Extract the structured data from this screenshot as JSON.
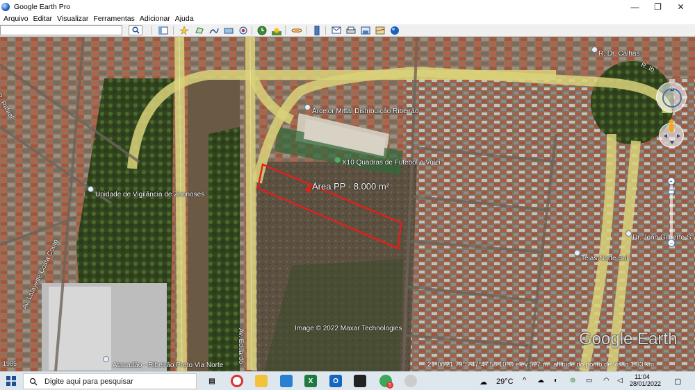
{
  "window": {
    "title": "Google Earth Pro",
    "minimize": "—",
    "maximize": "❐",
    "close": "✕"
  },
  "menu": [
    "Arquivo",
    "Editar",
    "Visualizar",
    "Ferramentas",
    "Adicionar",
    "Ajuda"
  ],
  "search": {
    "value": "",
    "button_icon": "search-icon"
  },
  "toolbar": {
    "icons": [
      "sidebar-icon",
      "placemark-icon",
      "polygon-icon",
      "path-icon",
      "overlay-icon",
      "record-tour-icon",
      "historical-imagery-icon",
      "sun-icon",
      "planets-icon",
      "ruler-icon",
      "email-icon",
      "print-icon",
      "save-image-icon",
      "map-icon",
      "earth-icon"
    ]
  },
  "map": {
    "polygon_label": "Área PP - 8.000 m²",
    "places": [
      {
        "name": "Arcelor Mittal Distribuição Ribeirão"
      },
      {
        "name": "X10 Quadras de Futebol e Volei"
      },
      {
        "name": "Unidade de Vigilância de Zoonoses"
      },
      {
        "name": "R. Dr. Calhas"
      },
      {
        "name": "Dr. João Gilberto S"
      },
      {
        "name": "Telas Norte Sul"
      },
      {
        "name": "Atacadão - Ribeirão Preto Via Norte"
      }
    ],
    "streets": [
      "Av. Lafayette Costa Couto",
      "Av. Eduardo",
      "R. Rafael",
      "R. Ib"
    ],
    "attribution": "Image © 2022 Maxar Technologies",
    "watermark": "Google Earth",
    "year": "1985",
    "status": {
      "coords": "21°08'21.79\"S   47°47'58.10\"O   elev   527 m",
      "eye_alt": "altitude do ponto de visão   1,33 km"
    },
    "colors": {
      "polygon": "#e0201b",
      "road": "#d9d27a"
    }
  },
  "taskbar": {
    "search_placeholder": "Digite aqui para pesquisar",
    "weather": "29°C",
    "time": "11:04",
    "date": "28/01/2022",
    "notification_badge": "5"
  }
}
